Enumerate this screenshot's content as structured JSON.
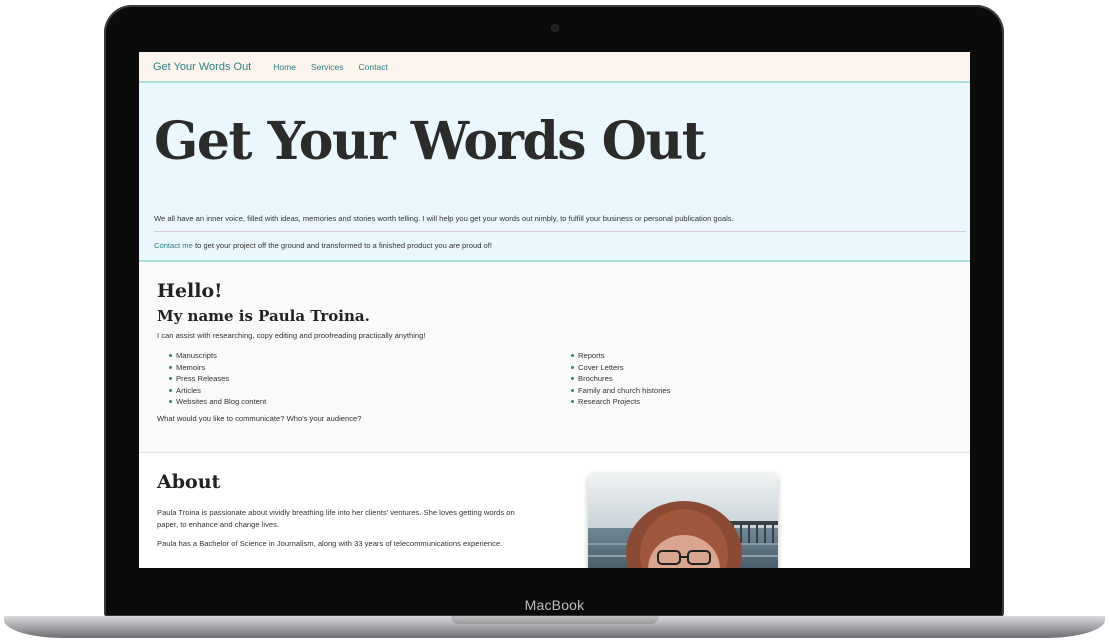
{
  "device": {
    "brand": "MacBook"
  },
  "nav": {
    "brand": "Get Your Words Out",
    "links": [
      "Home",
      "Services",
      "Contact"
    ]
  },
  "hero": {
    "title": "Get Your Words Out",
    "intro": "We all have an inner voice, filled with ideas, memories and stories worth telling. I will help you get your words out nimbly, to fulfill your business or personal publication goals.",
    "cta_link": "Contact me",
    "cta_rest": " to get your project off the ground and transformed to a finished product you are proud of!"
  },
  "hello": {
    "title": "Hello!",
    "subtitle": "My name is Paula Troina.",
    "text": "I can assist with researching, copy editing and proofreading practically anything!",
    "services_left": [
      "Manuscripts",
      "Memoirs",
      "Press Releases",
      "Articles",
      "Websites and Blog content"
    ],
    "services_right": [
      "Reports",
      "Cover Letters",
      "Brochures",
      "Family and church histories",
      "Research Projects"
    ],
    "question": "What would you like to communicate? Who's your audience?"
  },
  "about": {
    "title": "About",
    "p1": "Paula Troina is passionate about vividly breathing life into her clients' ventures. She loves getting words on paper, to enhance and change lives.",
    "p2": "Paula has a Bachelor of Science in Journalism, along with 33 years of telecommunications experience."
  },
  "colors": {
    "accent": "#2f7f86",
    "hero_bg": "#eaf7fc",
    "nav_bg": "#fbf4ed"
  }
}
